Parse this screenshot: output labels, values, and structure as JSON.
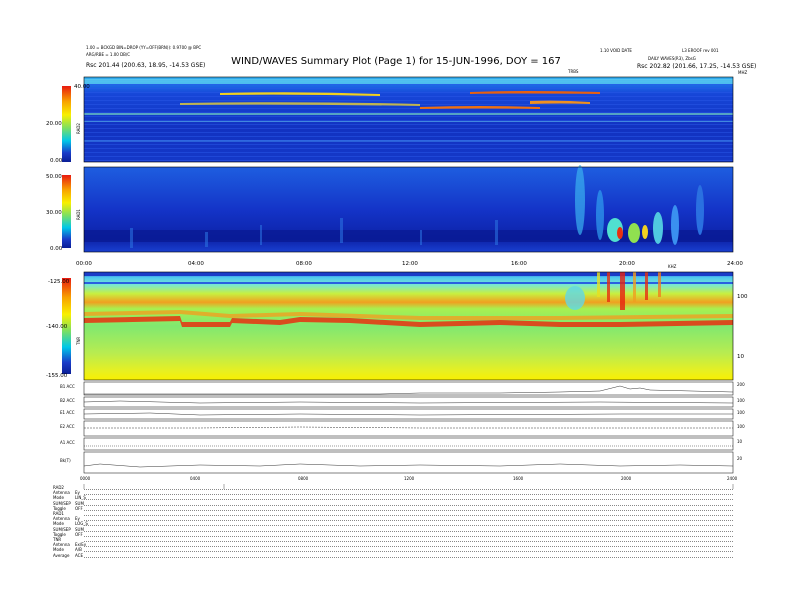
{
  "header": {
    "title": "WIND/WAVES Summary Plot (Page 1) for 15-JUN-1996, DOY = 167",
    "left_line1": "1.00 = BCKGD BIN=DROP (YY=OFF(BRN)): 0.9700 @ BPC",
    "left_line2": "ARG/RBE = 1.00 DB/C",
    "left_line3": "Rsc    201.44 (200.63, 18.95, -14.53 GSE)",
    "right_line1": "1.10 VOID DATE",
    "right_line1b": "L3 EROOF rev 001",
    "right_line2": "DAILY WAVES(R3), ZbsG",
    "right_line3": "Rsc    202.82 (201.66, 17.25, -14.53 GSE)",
    "tnr_unit": "TRBS",
    "mhz_unit": "MHZ"
  },
  "rad2": {
    "label": "RAD2",
    "ticks": [
      "40.00",
      "20.00",
      "0.00"
    ]
  },
  "rad1": {
    "label": "RAD1",
    "ticks": [
      "50.00",
      "30.00",
      "0.00"
    ]
  },
  "time_axis": {
    "ticks": [
      "00:00",
      "04:00",
      "08:00",
      "12:00",
      "16:00",
      "20:00",
      "24:00"
    ],
    "khz_unit": "KHZ"
  },
  "tnr": {
    "label": "TNR",
    "ticks": [
      "-125.00",
      "-140.00",
      "-155.00"
    ],
    "right_ticks": [
      "100",
      "10"
    ]
  },
  "lines": [
    {
      "label": "B1 ACC",
      "right": "200"
    },
    {
      "label": "B2 ACC",
      "right": "100"
    },
    {
      "label": "E1 ACC",
      "right": "100"
    },
    {
      "label": "E2 ACC",
      "right": "100"
    },
    {
      "label": "A1 ACC",
      "right": "10"
    },
    {
      "label": "Bk(T)",
      "right": "20"
    }
  ],
  "bottom_axis": {
    "ticks": [
      "0000",
      "0400",
      "0800",
      "1200",
      "1600",
      "2000",
      "2400"
    ]
  },
  "status": [
    {
      "name": "RAD2",
      "value": ""
    },
    {
      "name": "Antenna",
      "value": "Ey"
    },
    {
      "name": "Mode",
      "value": "LIN_S"
    },
    {
      "name": "SUM/SEP",
      "value": "SUM"
    },
    {
      "name": "Toggle",
      "value": "OFF"
    },
    {
      "name": "RAD1",
      "value": ""
    },
    {
      "name": "Antenna",
      "value": "Ey"
    },
    {
      "name": "Mode",
      "value": "LOG_S"
    },
    {
      "name": "SUM/SEP",
      "value": "SUM"
    },
    {
      "name": "Toggle",
      "value": "OFF"
    },
    {
      "name": "TNR",
      "value": ""
    },
    {
      "name": "Antenna",
      "value": "Ex/Ey"
    },
    {
      "name": "Mode",
      "value": "A/B"
    },
    {
      "name": "Average",
      "value": "ACE"
    }
  ],
  "colors": {
    "deep_blue": "#0a1e96",
    "blue": "#1a3cc8",
    "cyan": "#00c8e8",
    "green": "#7ee060",
    "yellow": "#f8f000",
    "red": "#e81a10"
  },
  "chart_data": [
    {
      "type": "heatmap",
      "name": "RAD2",
      "x_range_hours": [
        0,
        24
      ],
      "ylim": [
        0,
        40
      ],
      "y_ticks": [
        40,
        20,
        0
      ],
      "colorbar_range": [
        0,
        40
      ]
    },
    {
      "type": "heatmap",
      "name": "RAD1",
      "x_range_hours": [
        0,
        24
      ],
      "ylim": [
        0,
        50
      ],
      "y_ticks": [
        50,
        30,
        0
      ],
      "colorbar_range": [
        0,
        50
      ]
    },
    {
      "type": "heatmap",
      "name": "TNR",
      "x_range_hours": [
        0,
        24
      ],
      "colorbar_range": [
        -155,
        -125
      ],
      "y_ticks": [
        -125,
        -140,
        -155
      ],
      "right_axis_ticks_khz": [
        100,
        10
      ]
    },
    {
      "type": "line",
      "name": "line-plots",
      "x_range_hours": [
        0,
        24
      ],
      "panels": [
        "B1 ACC",
        "B2 ACC",
        "E1 ACC",
        "E2 ACC",
        "A1 ACC",
        "Bk(T)"
      ]
    }
  ]
}
